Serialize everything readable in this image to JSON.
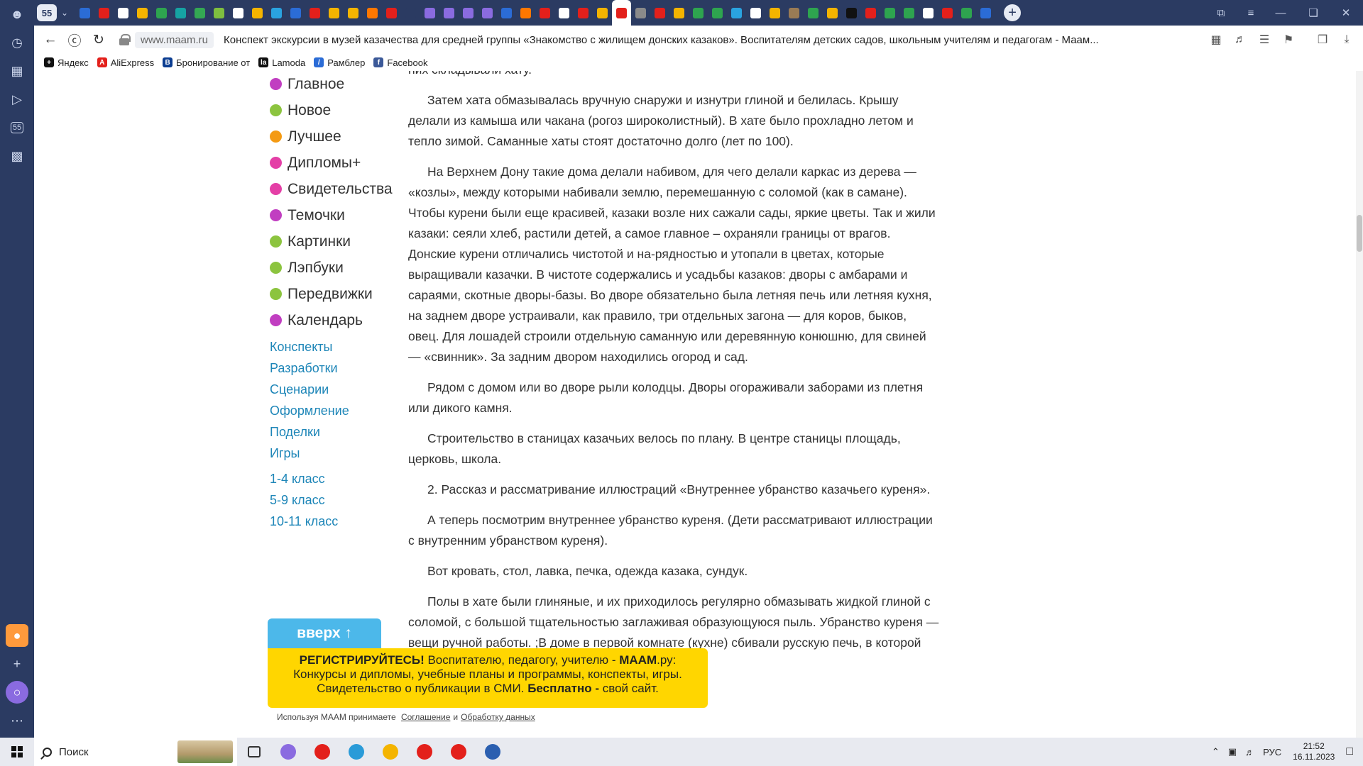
{
  "sidepanel": {
    "badge_label": "55"
  },
  "tabstrip": {
    "tab_counter": "55",
    "tab_colors": [
      "#2b6cd6",
      "#e3201b",
      "#ffffff",
      "#f4b400",
      "#2ea44f",
      "#16a3a3",
      "#34a853",
      "#7fbf3f",
      "#ffffff",
      "#f4b400",
      "#2aa3e0",
      "#2b6cd6",
      "#e3201b",
      "#f4b400",
      "#f4b400",
      "#ff7700",
      "#e3201b",
      "#2b3b62",
      "#8a6be0",
      "#8a6be0",
      "#8a6be0",
      "#8a6be0",
      "#2b6cd6",
      "#ff7700",
      "#e3201b",
      "#ffffff",
      "#e3201b",
      "#f4b400",
      "#f4b400",
      "#8a8a8a",
      "#e3201b",
      "#f4b400",
      "#2ea44f",
      "#2ea44f",
      "#2aa3e0",
      "#ffffff",
      "#f4b400",
      "#9a7b55",
      "#2ea44f",
      "#f4b400",
      "#111111",
      "#e3201b",
      "#2ea44f",
      "#2ea44f",
      "#ffffff",
      "#e3201b",
      "#2ea44f",
      "#2b6cd6"
    ],
    "active_tab_index": 28
  },
  "addressbar": {
    "domain": "www.maam.ru",
    "page_title": "Конспект экскурсии в музей казачества для средней группы «Знакомство с жилищем донских казаков». Воспитателям детских садов, школьным учителям и педагогам - Маам..."
  },
  "bookmarks": [
    {
      "label": "Яндекс",
      "color": "#111111",
      "glyph": "+"
    },
    {
      "label": "AliExpress",
      "color": "#e3201b",
      "glyph": "A"
    },
    {
      "label": "Бронирование от",
      "color": "#0b3d91",
      "glyph": "B"
    },
    {
      "label": "Lamoda",
      "color": "#111111",
      "glyph": "la"
    },
    {
      "label": "Рамблер",
      "color": "#2b6cd6",
      "glyph": "/"
    },
    {
      "label": "Facebook",
      "color": "#3b5998",
      "glyph": "f"
    }
  ],
  "categories": [
    {
      "label": "Главное",
      "color": "#c13ec1"
    },
    {
      "label": "Новое",
      "color": "#8cc43f"
    },
    {
      "label": "Лучшее",
      "color": "#f49a13"
    },
    {
      "label": "Дипломы+",
      "color": "#e43fa6"
    },
    {
      "label": "Свидетельства",
      "color": "#e43fa6"
    },
    {
      "label": "Темочки",
      "color": "#c13ec1"
    },
    {
      "label": "Картинки",
      "color": "#8cc43f"
    },
    {
      "label": "Лэпбуки",
      "color": "#8cc43f"
    },
    {
      "label": "Передвижки",
      "color": "#8cc43f"
    },
    {
      "label": "Календарь",
      "color": "#c13ec1"
    }
  ],
  "menu_links": [
    "Конспекты",
    "Разработки",
    "Сценарии",
    "Оформление",
    "Поделки",
    "Игры"
  ],
  "grade_links": [
    "1-4 класс",
    "5-9 класс",
    "10-11 класс"
  ],
  "article": [
    "них складывали хату.",
    "Затем хата обмазывалась вручную снаружи и изнутри глиной и белилась. Крышу делали из камыша или чакана (рогоз широколистный). В хате было прохладно летом и тепло зимой. Саманные хаты стоят достаточно долго (лет по 100).",
    "На Верхнем Дону такие дома делали набивом, для чего делали каркас из дерева — «козлы», между которыми набивали землю, перемешанную с соломой (как в самане). Чтобы курени были еще красивей, казаки возле них сажали сады, яркие цветы. Так и жили казаки: сеяли хлеб, растили детей, а самое главное – охраняли границы от врагов. Донские курени отличались чистотой и на-рядностью и утопали в цветах, которые выращивали казачки. В чистоте содержались и усадьбы казаков: дворы с амбарами и сараями, скотные дворы-базы. Во дворе обязательно была летняя печь или летняя кухня, на заднем дворе устраивали, как правило, три отдельных загона — для коров, быков, овец. Для лошадей строили отдельную саманную или деревянную конюшню, для свиней — «свинник». За задним двором находились огород и сад.",
    "Рядом с домом или во дворе рыли колодцы. Дворы огораживали заборами из плетня или дикого камня.",
    "Строительство в станицах казачьих велось по плану. В центре станицы площадь, церковь, школа.",
    "2. Рассказ и рассматривание иллюстраций «Внутреннее убранство казачьего куреня».",
    "А теперь посмотрим внутреннее убранство куреня. (Дети рассматривают иллюстрации с внутренним убранством куреня).",
    "Вот кровать, стол, лавка, печка, одежда казака, сундук.",
    "Полы в хате были глиняные, и их приходилось регулярно обмазывать жидкой глиной с соломой, с большой тщательностью заглаживая образующуюся пыль. Убранство куреня — вещи ручной работы. ;В доме в первой комнате (кухне) сбивали русскую печь, в которой готовили еду. На припечке же спали дети или"
  ],
  "top_button": {
    "label": "вверх ↑"
  },
  "reg_banner": {
    "line1_bold": "РЕГИСТРИРУЙТЕСЬ!",
    "line1_rest": " Воспитателю, педагогу, учителю - ",
    "line1_brand": "МААМ",
    "line1_end": ".ру:",
    "line2": "Конкурсы и дипломы, учебные планы и программы, конспекты, игры.",
    "line3_start": "Свидетельство о публикации в СМИ. ",
    "line3_bold": "Бесплатно -",
    "line3_end": " свой сайт."
  },
  "consent": {
    "prefix": "Используя МААМ принимаете",
    "link1": "Соглашение",
    "and": "и",
    "link2": "Обработку данных"
  },
  "taskbar": {
    "search_label": "Поиск",
    "app_colors": [
      "#8a6be0",
      "#e3201b",
      "#2a9bd8",
      "#f4b400",
      "#e3201b",
      "#e3201b",
      "#2b5fb0"
    ],
    "lang": "РУС",
    "time": "21:52",
    "date": "16.11.2023"
  }
}
